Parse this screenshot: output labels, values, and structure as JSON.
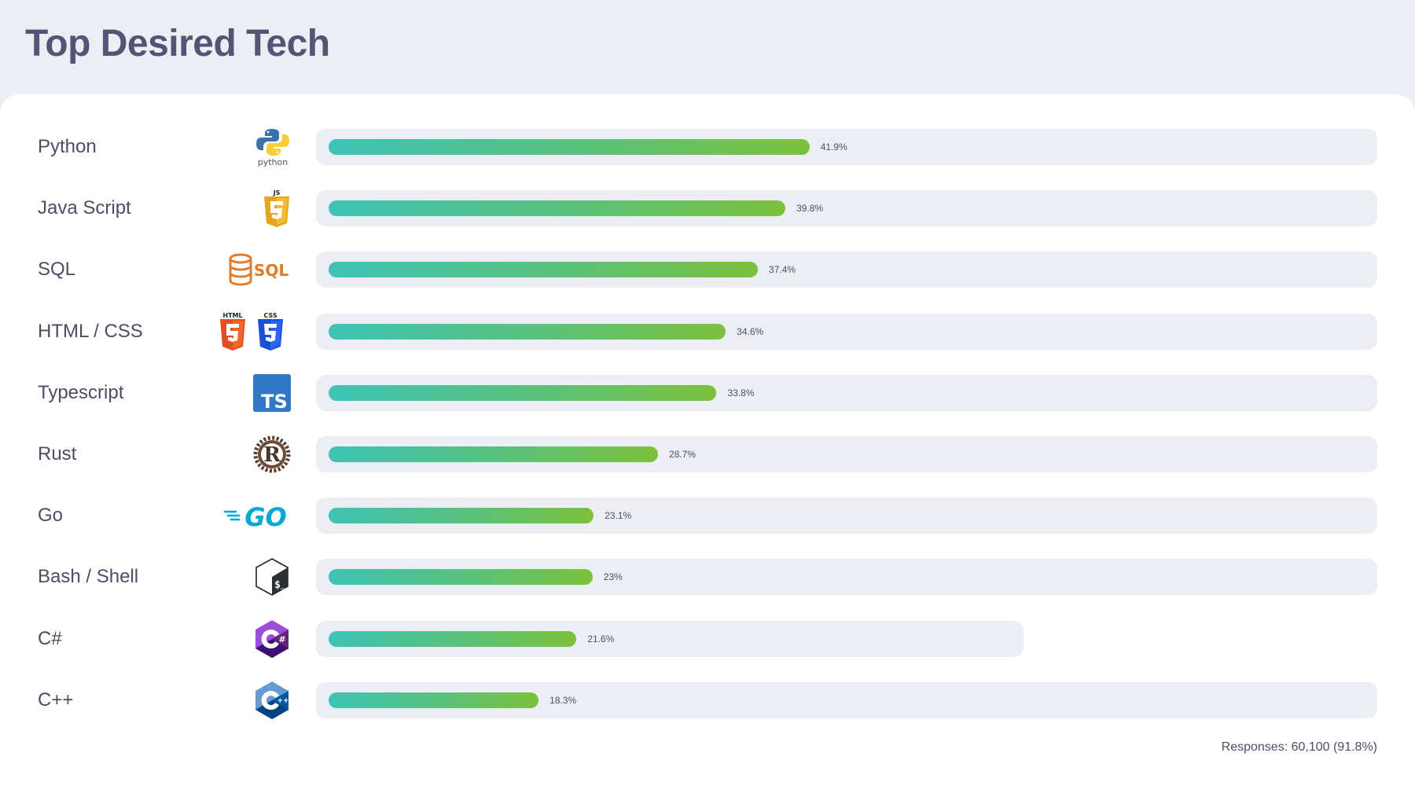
{
  "header": {
    "title": "Top Desired Tech"
  },
  "footer": {
    "responses": "Responses: 60,100 (91.8%)"
  },
  "colors": {
    "bar_gradient_start": "#3ec3b6",
    "bar_gradient_end": "#7cc13c",
    "track": "#eceef3",
    "title": "#525674"
  },
  "chart_data": {
    "type": "bar",
    "orientation": "horizontal",
    "title": "Top Desired Tech",
    "xlabel": "",
    "ylabel": "",
    "unit": "%",
    "categories": [
      "Python",
      "Java Script",
      "SQL",
      "HTML / CSS",
      "Typescript",
      "Rust",
      "Go",
      "Bash / Shell",
      "C#",
      "C++"
    ],
    "values": [
      41.9,
      39.8,
      37.4,
      34.6,
      33.8,
      28.7,
      23.1,
      23,
      21.6,
      18.3
    ],
    "value_labels": [
      "41.9%",
      "39.8%",
      "37.4%",
      "34.6%",
      "33.8%",
      "28.7%",
      "23.1%",
      "23%",
      "21.6%",
      "18.3%"
    ],
    "icons": [
      "python-logo-icon",
      "javascript-logo-icon",
      "sql-database-icon",
      "html-css-logo-icon",
      "typescript-logo-icon",
      "rust-logo-icon",
      "go-logo-icon",
      "bash-shell-icon",
      "csharp-logo-icon",
      "cplusplus-logo-icon"
    ],
    "short_track": [
      false,
      false,
      false,
      false,
      false,
      false,
      false,
      false,
      true,
      false
    ],
    "grid": false,
    "legend": "none"
  }
}
